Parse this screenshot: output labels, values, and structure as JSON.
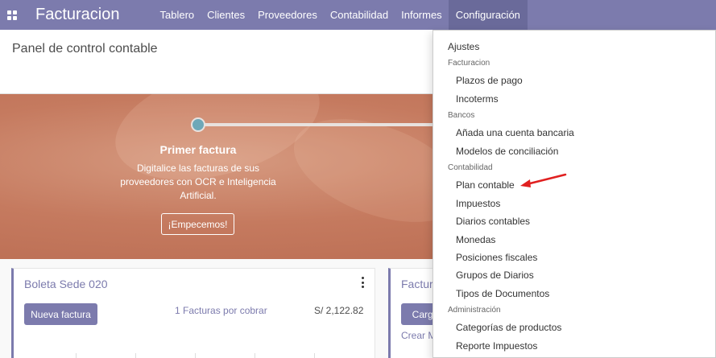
{
  "navbar": {
    "brand": "Facturacion",
    "menu": [
      "Tablero",
      "Clientes",
      "Proveedores",
      "Contabilidad",
      "Informes",
      "Configuración"
    ],
    "active_menu": "Configuración",
    "bg_color": "#7c7bad"
  },
  "control_panel": {
    "title": "Panel de control contable"
  },
  "onboarding": {
    "step_title": "Primer factura",
    "step_desc": "Digitalice las facturas de sus proveedores con OCR e Inteligencia Artificial.",
    "button_label": "¡Empecemos!"
  },
  "cards": [
    {
      "title": "Boleta Sede 020",
      "button": "Nueva factura",
      "link": "1 Facturas por cobrar",
      "amount": "S/ 2,122.82"
    },
    {
      "title": "Factur",
      "button": "Carga",
      "link": "Crear M"
    }
  ],
  "dropdown": {
    "ajustes": "Ajustes",
    "facturacion_header": "Facturacion",
    "plazos": "Plazos de pago",
    "incoterms": "Incoterms",
    "bancos_header": "Bancos",
    "cuenta_bancaria": "Añada una cuenta bancaria",
    "conciliacion": "Modelos de conciliación",
    "contabilidad_header": "Contabilidad",
    "plan_contable": "Plan contable",
    "impuestos": "Impuestos",
    "diarios": "Diarios contables",
    "monedas": "Monedas",
    "posiciones": "Posiciones fiscales",
    "grupos": "Grupos de Diarios",
    "tipos": "Tipos de Documentos",
    "administracion_header": "Administración",
    "categorias": "Categorías de productos",
    "reporte": "Reporte Impuestos"
  },
  "annotation": {
    "arrow_color": "#e02020",
    "arrow_target": "Plan contable"
  }
}
